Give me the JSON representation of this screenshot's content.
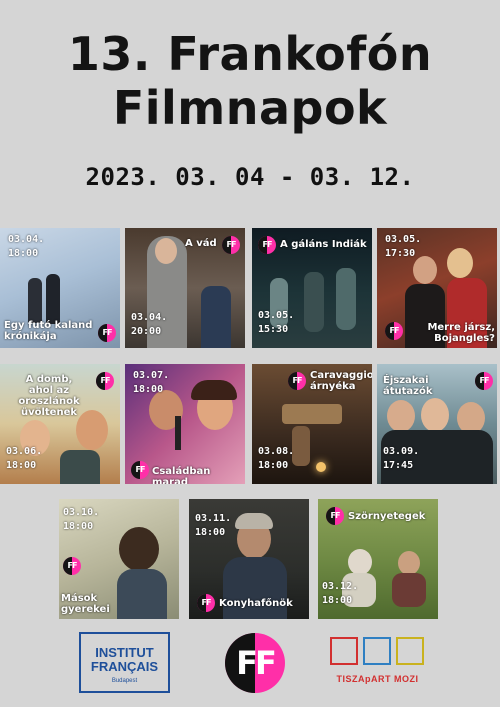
{
  "header": {
    "title_line1": "13. Frankofón",
    "title_line2": "Filmnapok",
    "dates": "2023. 03. 04 - 03. 12."
  },
  "badge_text": "FF",
  "films": [
    {
      "title": "Egy futó kaland krónikája",
      "date": "03.04.",
      "time": "18:00"
    },
    {
      "title": "A vád",
      "date": "03.04.",
      "time": "20:00"
    },
    {
      "title": "A gáláns Indiák",
      "date": "03.05.",
      "time": "15:30"
    },
    {
      "title": "Merre jársz, Bojangles?",
      "date": "03.05.",
      "time": "17:30"
    },
    {
      "title": "A domb, ahol az oroszlánok üvöltenek",
      "date": "03.06.",
      "time": "18:00"
    },
    {
      "title": "Családban marad",
      "date": "03.07.",
      "time": "18:00"
    },
    {
      "title": "Caravaggio árnyéka",
      "date": "03.08.",
      "time": "18:00"
    },
    {
      "title": "Éjszakai átutazók",
      "date": "03.09.",
      "time": "17:45"
    },
    {
      "title": "Mások gyerekei",
      "date": "03.10.",
      "time": "18:00"
    },
    {
      "title": "Konyhafőnök",
      "date": "03.11.",
      "time": "18:00"
    },
    {
      "title": "Szörnyetegek",
      "date": "03.12.",
      "time": "18:00"
    }
  ],
  "logos": {
    "institut_name": "INSTITUT FRANÇAIS",
    "institut_city": "Budapest",
    "festival_mark": "FF",
    "cinema_name": "TISZApART MOZI"
  },
  "colors": {
    "background": "#d5d5d5",
    "accent_pink": "#ff2fa8",
    "institut_blue": "#1e4f9a",
    "cinema_red": "#d23030"
  }
}
